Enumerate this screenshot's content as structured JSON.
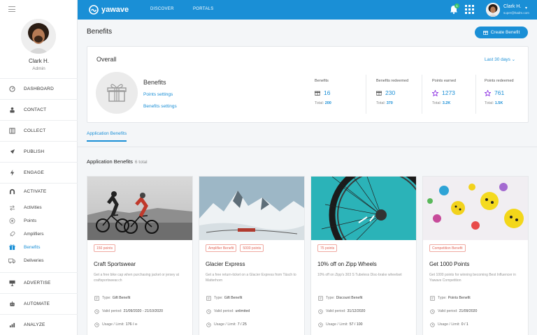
{
  "brand": {
    "name": "yawave",
    "accent": "#1a8fd6",
    "tag_color": "#e2685a"
  },
  "topnav": {
    "discover": "DISCOVER",
    "portals": "PORTALS"
  },
  "notifications": {
    "count": "1"
  },
  "user": {
    "name": "Clark H.",
    "role": "Admin",
    "email": "super@hadm.com",
    "top_name": "Clark H."
  },
  "sidebar": {
    "items": [
      {
        "label": "DASHBOARD",
        "icon": "dashboard-icon"
      },
      {
        "label": "CONTACT",
        "icon": "contact-icon"
      },
      {
        "label": "COLLECT",
        "icon": "collect-icon"
      },
      {
        "label": "PUBLISH",
        "icon": "publish-icon"
      },
      {
        "label": "ENGAGE",
        "icon": "engage-icon"
      },
      {
        "label": "ACTIVATE",
        "icon": "magnet-icon"
      }
    ],
    "activate_sub": [
      {
        "label": "Activities",
        "icon": "arrows-icon"
      },
      {
        "label": "Points",
        "icon": "points-icon"
      },
      {
        "label": "Amplifiers",
        "icon": "rocket-icon"
      },
      {
        "label": "Benefits",
        "icon": "gift-icon",
        "active": true
      },
      {
        "label": "Deliveries",
        "icon": "truck-icon"
      }
    ],
    "bottom": [
      {
        "label": "ADVERTISE",
        "icon": "billboard-icon"
      },
      {
        "label": "AUTOMATE",
        "icon": "robot-icon"
      },
      {
        "label": "ANALYZE",
        "icon": "chart-icon"
      }
    ]
  },
  "page": {
    "title": "Benefits",
    "create_button": "Create Benefit"
  },
  "overall": {
    "title": "Overall",
    "period": "Last 30 days",
    "benefits_title": "Benefits",
    "link_points": "Points settings",
    "link_benefits": "Benefits settings",
    "stats": [
      {
        "label": "Benefits",
        "value": "16",
        "total_label": "Total:",
        "total": "200"
      },
      {
        "label": "Benefits redeemed",
        "value": "230",
        "total_label": "Total:",
        "total": "370"
      },
      {
        "label": "Points earned",
        "value": "1273",
        "total_label": "Total:",
        "total": "3.2K"
      },
      {
        "label": "Points redeemed",
        "value": "761",
        "total_label": "Total:",
        "total": "1.5K"
      }
    ]
  },
  "tabs": {
    "application": "Application Benefits"
  },
  "section": {
    "title": "Application Benefits",
    "count": "6 total"
  },
  "cards": [
    {
      "tags": [
        "150 points"
      ],
      "title": "Craft Sportswear",
      "desc": "Get a free bike cap when purchasing jacket or jersey at craftsportswear.ch",
      "type_label": "Type:",
      "type": "Gift Benefit",
      "valid_label": "Valid period:",
      "valid": "21/09/2020 - 21/10/2020",
      "usage_label": "Usage / Limit:",
      "usage": "176 / ∞"
    },
    {
      "tags": [
        "Amplifier Benefit",
        "5000 points"
      ],
      "title": "Glacier Express",
      "desc": "Get a free return-ticket on a Glacier Express from Täsch to Matterhorn",
      "type_label": "Type:",
      "type": "Gift Benefit",
      "valid_label": "Valid period:",
      "valid": "unlimited",
      "usage_label": "Usage / Limit:",
      "usage": "7 / 25"
    },
    {
      "tags": [
        "75 points"
      ],
      "title": "10% off on Zipp Wheels",
      "desc": "10% off on Zipp's 303 S Tubeless Disc-brake wheelset",
      "type_label": "Type:",
      "type": "Discount Benefit",
      "valid_label": "Valid period:",
      "valid": "31/12/2020",
      "usage_label": "Usage / Limit:",
      "usage": "57 / 100"
    },
    {
      "tags": [
        "Competition Benefit"
      ],
      "title": "Get 1000 Points",
      "desc": "Get 1000 points for winning becoming Best Influencer in Yawave Competition",
      "type_label": "Type:",
      "type": "Points Benefit",
      "valid_label": "Valid period:",
      "valid": "21/09/2020",
      "usage_label": "Usage / Limit:",
      "usage": "0 / 1"
    }
  ]
}
